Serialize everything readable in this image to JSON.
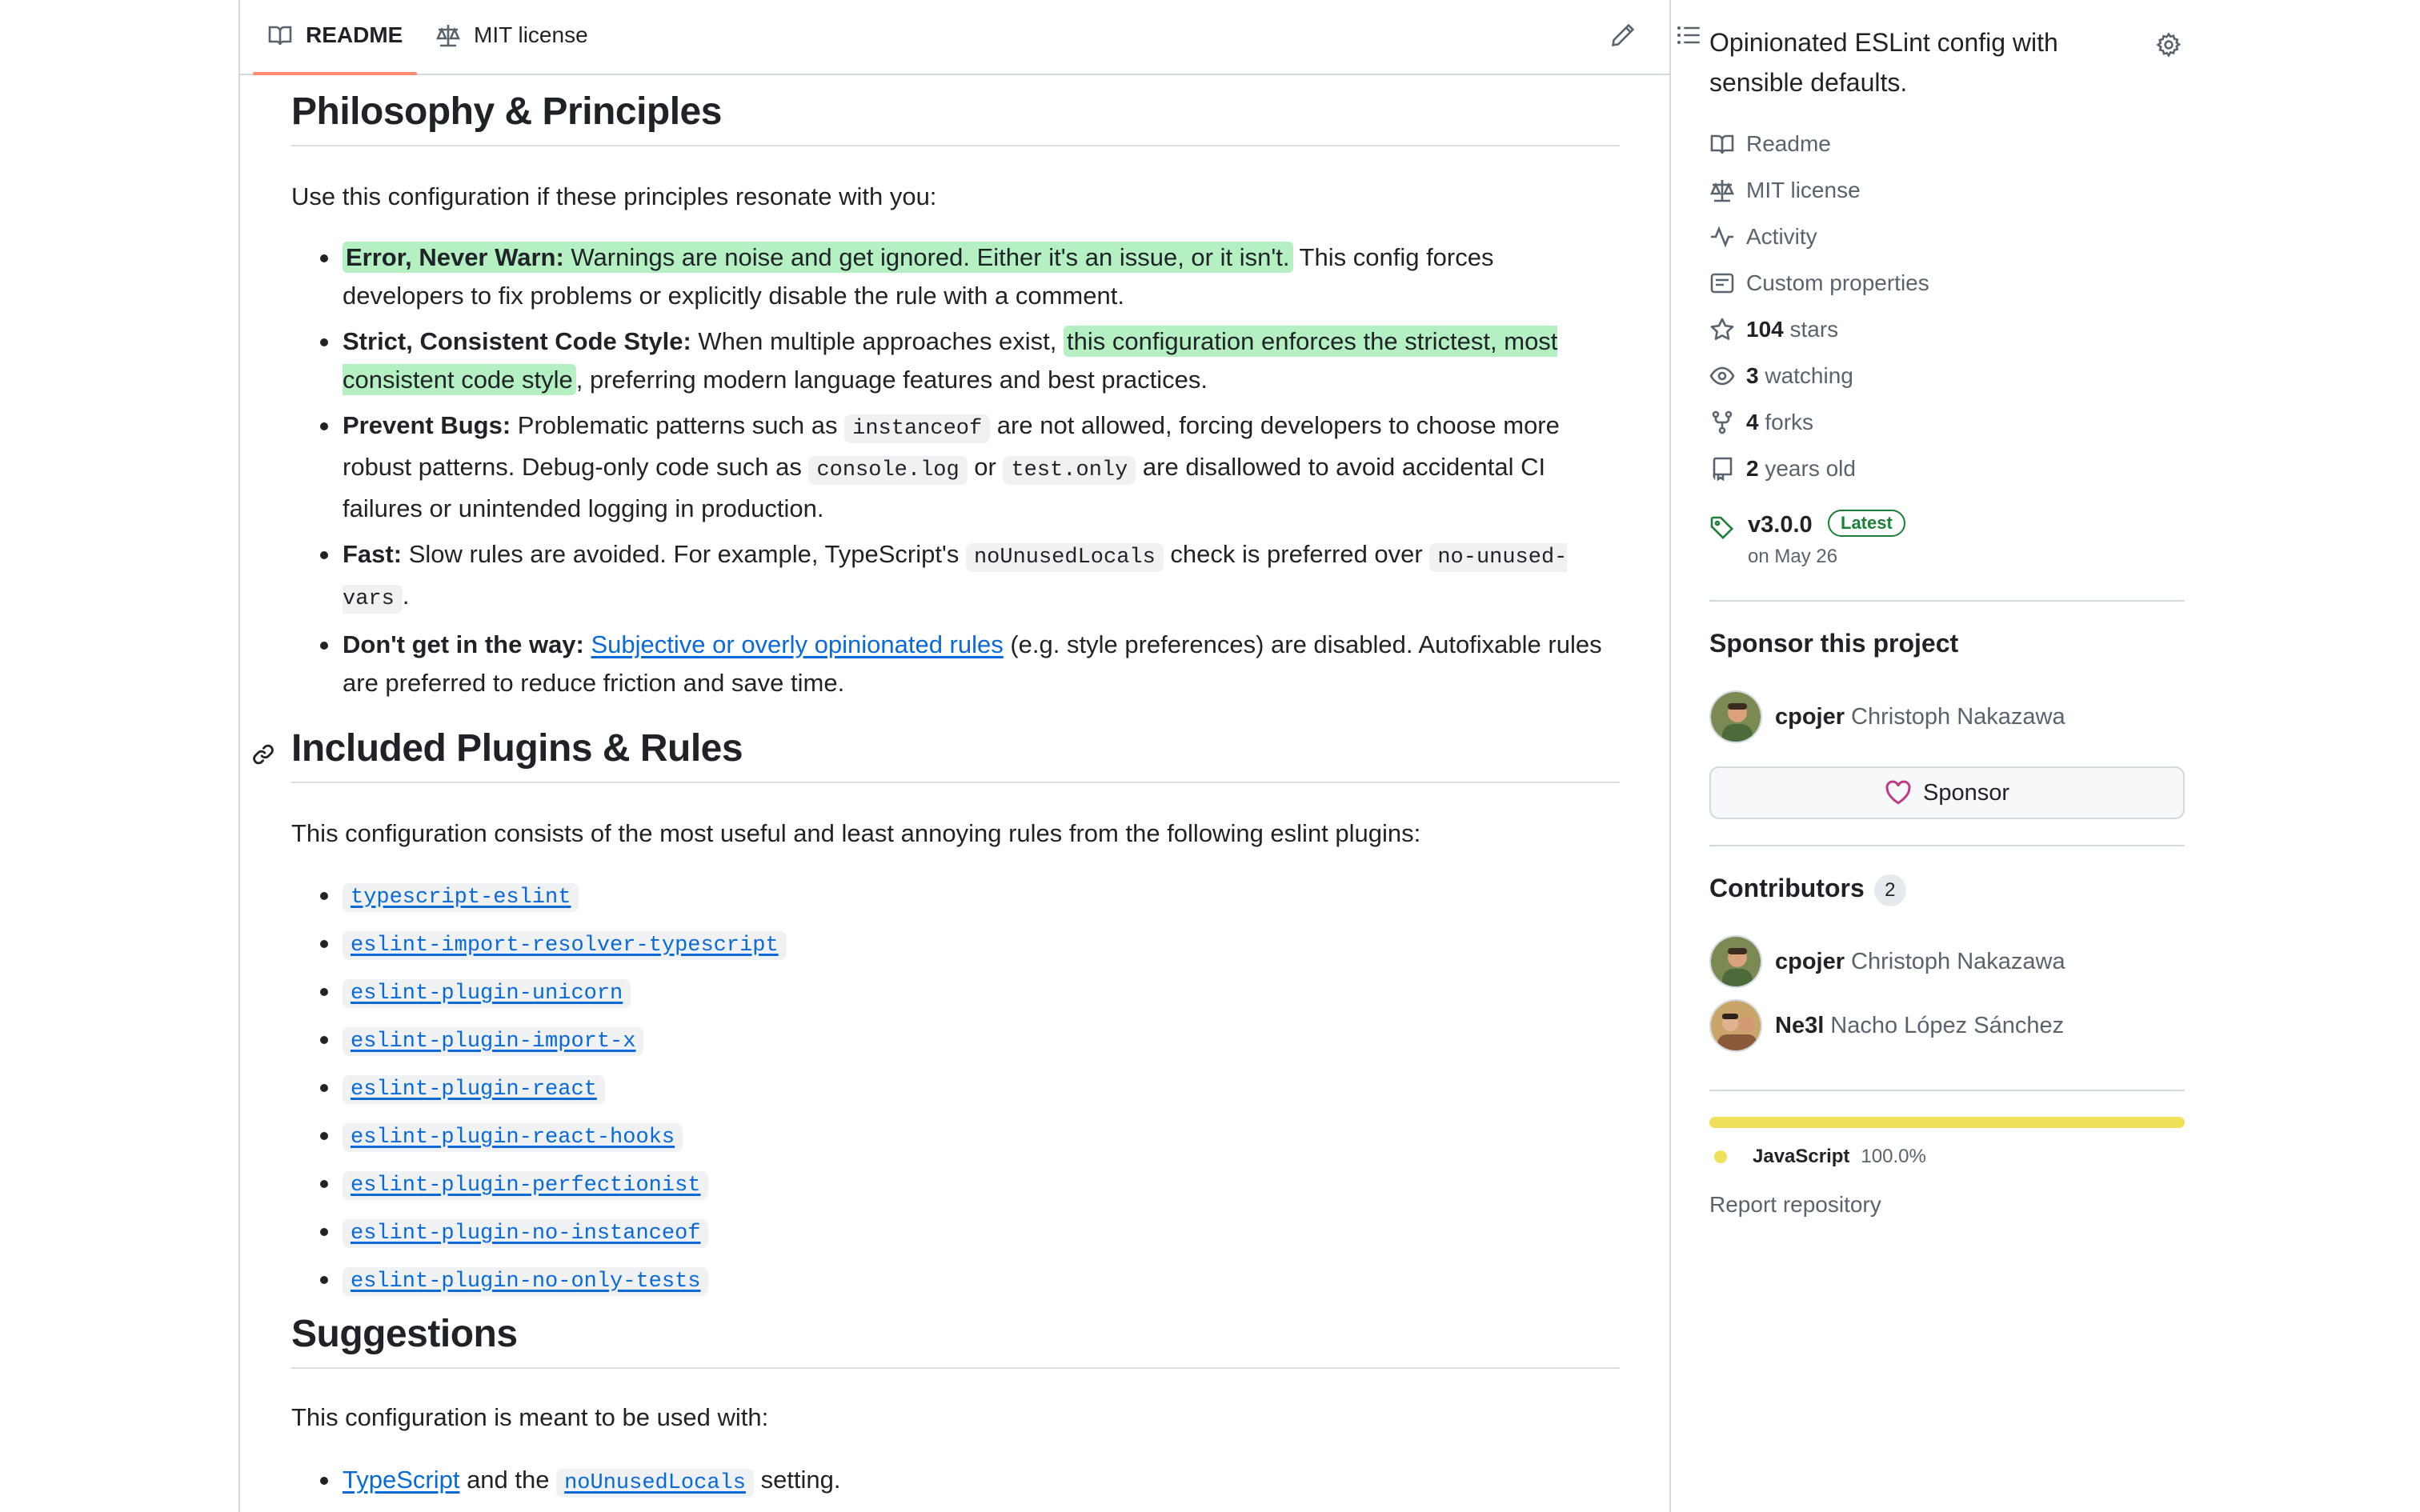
{
  "readme_tabs": {
    "readme_label": "README",
    "license_label": "MIT license"
  },
  "readme": {
    "philosophy": {
      "heading": "Philosophy & Principles",
      "intro": "Use this configuration if these principles resonate with you:",
      "items": [
        {
          "title": "Error, Never Warn:",
          "highlight": "Warnings are noise and get ignored. Either it's an issue, or it isn't.",
          "rest": " This config forces developers to fix problems or explicitly disable the rule with a comment."
        },
        {
          "title": "Strict, Consistent Code Style:",
          "pre": " When multiple approaches exist, ",
          "highlight": "this configuration enforces the strictest, most consistent code style",
          "rest": ", preferring modern language features and best practices."
        },
        {
          "title": "Prevent Bugs:",
          "t1": " Problematic patterns such as ",
          "code1": "instanceof",
          "t2": " are not allowed, forcing developers to choose more robust patterns. Debug-only code such as ",
          "code2": "console.log",
          "t3": " or ",
          "code3": "test.only",
          "t4": " are disallowed to avoid accidental CI failures or unintended logging in production."
        },
        {
          "title": "Fast:",
          "t1": " Slow rules are avoided. For example, TypeScript's ",
          "code1": "noUnusedLocals",
          "t2": " check is preferred over ",
          "code2": "no-unused-vars",
          "t3": "."
        },
        {
          "title": "Don't get in the way:",
          "link": "Subjective or overly opinionated rules",
          "rest": " (e.g. style preferences) are disabled. Autofixable rules are preferred to reduce friction and save time."
        }
      ]
    },
    "plugins": {
      "heading": "Included Plugins & Rules",
      "intro": "This configuration consists of the most useful and least annoying rules from the following eslint plugins:",
      "items": [
        "typescript-eslint",
        "eslint-import-resolver-typescript",
        "eslint-plugin-unicorn",
        "eslint-plugin-import-x",
        "eslint-plugin-react",
        "eslint-plugin-react-hooks",
        "eslint-plugin-perfectionist",
        "eslint-plugin-no-instanceof",
        "eslint-plugin-no-only-tests"
      ]
    },
    "suggestions": {
      "heading": "Suggestions",
      "intro": "This configuration is meant to be used with:",
      "item_link": "TypeScript",
      "item_t1": " and the ",
      "item_code": "noUnusedLocals",
      "item_t2": " setting."
    }
  },
  "sidebar": {
    "about": "Opinionated ESLint config with sensible defaults.",
    "links": {
      "readme": "Readme",
      "license": "MIT license",
      "activity": "Activity",
      "custom_properties": "Custom properties",
      "stars_count": "104",
      "stars_label": " stars",
      "watching_count": "3",
      "watching_label": " watching",
      "forks_count": "4",
      "forks_label": " forks",
      "age_count": "2",
      "age_label": " years old"
    },
    "release": {
      "version": "v3.0.0",
      "badge": "Latest",
      "date": "on May 26"
    },
    "sponsor": {
      "heading": "Sponsor this project",
      "login": "cpojer",
      "name": "Christoph Nakazawa",
      "button": "Sponsor"
    },
    "contributors": {
      "heading": "Contributors",
      "count": "2",
      "people": [
        {
          "login": "cpojer",
          "name": "Christoph Nakazawa"
        },
        {
          "login": "Ne3l",
          "name": "Nacho López Sánchez"
        }
      ]
    },
    "languages": {
      "name": "JavaScript",
      "percent": "100.0%",
      "percent_value": 100,
      "color": "#f1e05a"
    },
    "report": "Report repository"
  }
}
